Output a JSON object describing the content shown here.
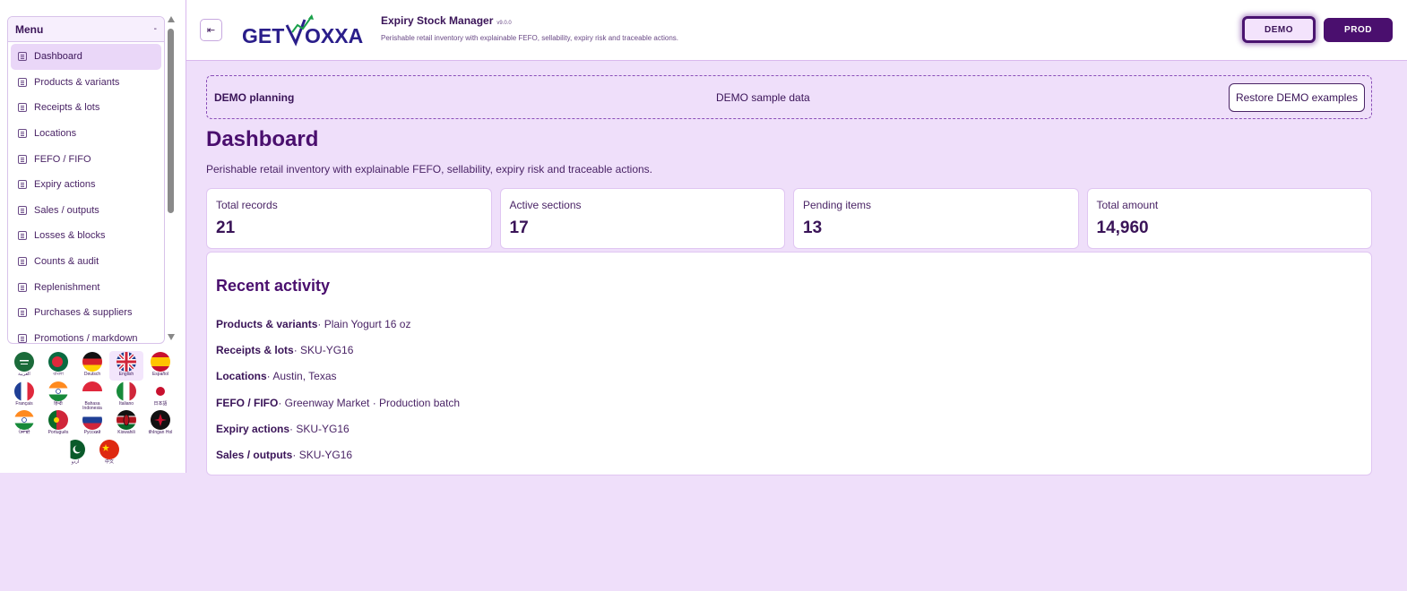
{
  "sidebar": {
    "menu_title": "Menu",
    "collapse_glyph": "-",
    "items": [
      {
        "label": "Dashboard",
        "active": true
      },
      {
        "label": "Products & variants"
      },
      {
        "label": "Receipts & lots"
      },
      {
        "label": "Locations"
      },
      {
        "label": "FEFO / FIFO"
      },
      {
        "label": "Expiry actions"
      },
      {
        "label": "Sales / outputs"
      },
      {
        "label": "Losses & blocks"
      },
      {
        "label": "Counts & audit"
      },
      {
        "label": "Replenishment"
      },
      {
        "label": "Purchases & suppliers"
      },
      {
        "label": "Promotions / markdown"
      }
    ],
    "languages": [
      {
        "label": "العربية",
        "flag": "saudi-arabia"
      },
      {
        "label": "বাংলা",
        "flag": "bangladesh"
      },
      {
        "label": "Deutsch",
        "flag": "germany"
      },
      {
        "label": "English",
        "flag": "united-kingdom",
        "selected": true
      },
      {
        "label": "Español",
        "flag": "spain"
      },
      {
        "label": "Français",
        "flag": "france"
      },
      {
        "label": "हिन्दी",
        "flag": "india"
      },
      {
        "label": "Bahasa Indonesia",
        "flag": "indonesia"
      },
      {
        "label": "Italiano",
        "flag": "italy"
      },
      {
        "label": "日本語",
        "flag": "japan"
      },
      {
        "label": "ਪੰਜਾਬੀ",
        "flag": "india"
      },
      {
        "label": "Português",
        "flag": "portugal"
      },
      {
        "label": "Русский",
        "flag": "russia"
      },
      {
        "label": "Kiswahili",
        "flag": "kenya"
      },
      {
        "label": "tlhIngan Hol",
        "flag": "klingon"
      },
      {
        "label": "اردو",
        "flag": "pakistan"
      },
      {
        "label": "中文",
        "flag": "china"
      }
    ]
  },
  "header": {
    "toggle_glyph": "⇤",
    "logo_text_left": "GET",
    "logo_text_right": "OXXA",
    "title": "Expiry Stock Manager",
    "version": "v9.0.0",
    "subtitle": "Perishable retail inventory with explainable FEFO, sellability, expiry risk and traceable actions.",
    "env_demo": "DEMO",
    "env_prod": "PROD"
  },
  "planning": {
    "label": "DEMO planning",
    "center_text": "DEMO sample data",
    "restore_button": "Restore DEMO examples"
  },
  "page": {
    "title": "Dashboard",
    "description": "Perishable retail inventory with explainable FEFO, sellability, expiry risk and traceable actions."
  },
  "stats": [
    {
      "label": "Total records",
      "value": "21"
    },
    {
      "label": "Active sections",
      "value": "17"
    },
    {
      "label": "Pending items",
      "value": "13"
    },
    {
      "label": "Total amount",
      "value": "14,960"
    }
  ],
  "activity": {
    "title": "Recent activity",
    "rows": [
      {
        "key": "Products & variants",
        "detail": " · Plain Yogurt 16 oz"
      },
      {
        "key": "Receipts & lots",
        "detail": " · SKU-YG16"
      },
      {
        "key": "Locations",
        "detail": " · Austin, Texas"
      },
      {
        "key": "FEFO / FIFO",
        "detail": " · Greenway Market · Production batch"
      },
      {
        "key": "Expiry actions",
        "detail": " · SKU-YG16"
      },
      {
        "key": "Sales / outputs",
        "detail": " · SKU-YG16"
      }
    ]
  },
  "colors": {
    "background": "#efdffa",
    "accent": "#4a0f6e",
    "text": "#3a1458"
  }
}
